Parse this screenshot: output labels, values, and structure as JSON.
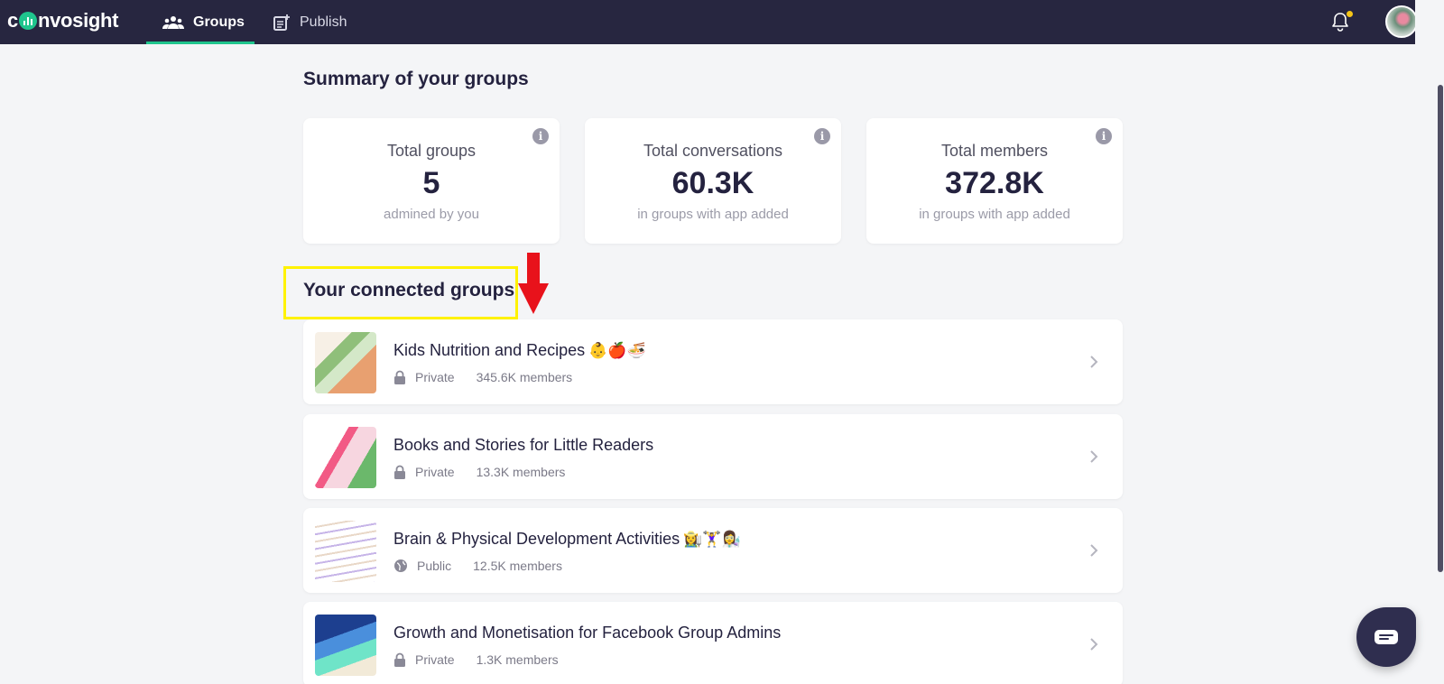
{
  "app": {
    "logo_text_left": "c",
    "logo_text_right": "nvosight",
    "brand_color": "#1fc58d",
    "nav_bg": "#272640"
  },
  "nav": {
    "tabs": [
      {
        "label": "Groups",
        "icon": "groups-icon",
        "active": true
      },
      {
        "label": "Publish",
        "icon": "publish-icon",
        "active": false
      }
    ],
    "notification_icon": "bell-icon",
    "notification_dot_color": "#f5c518",
    "avatar": "user-avatar"
  },
  "summary": {
    "title": "Summary of your groups",
    "cards": [
      {
        "label": "Total groups",
        "value": "5",
        "sub": "admined by you",
        "info_icon": "info-icon"
      },
      {
        "label": "Total conversations",
        "value": "60.3K",
        "sub": "in groups with app added",
        "info_icon": "info-icon"
      },
      {
        "label": "Total members",
        "value": "372.8K",
        "sub": "in groups with app added",
        "info_icon": "info-icon"
      }
    ]
  },
  "connected": {
    "title": "Your connected groups",
    "groups": [
      {
        "name": "Kids Nutrition and Recipes",
        "emoji": "👶🍎🍜",
        "privacy": "Private",
        "privacy_icon": "lock-icon",
        "members": "345.6K members"
      },
      {
        "name": "Books and Stories for Little Readers",
        "emoji": "",
        "privacy": "Private",
        "privacy_icon": "lock-icon",
        "members": "13.3K members"
      },
      {
        "name": "Brain & Physical Development Activities",
        "emoji": "👩‍🌾🏋️‍♀️👩‍🔬",
        "privacy": "Public",
        "privacy_icon": "globe-icon",
        "members": "12.5K members"
      },
      {
        "name": "Growth and Monetisation for Facebook Group Admins",
        "emoji": "",
        "privacy": "Private",
        "privacy_icon": "lock-icon",
        "members": "1.3K members"
      }
    ]
  },
  "annotations": {
    "highlight_color": "#fff200",
    "arrow_color": "#e8121b"
  },
  "chat": {
    "icon": "chat-icon"
  }
}
